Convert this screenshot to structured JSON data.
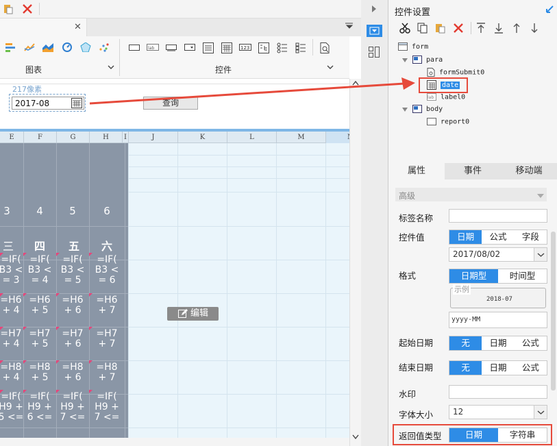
{
  "ribbon": {
    "chart_label": "图表",
    "control_label": "控件"
  },
  "form": {
    "size_hint": "217像素",
    "date_value": "2017-08",
    "query_button": "查询"
  },
  "grid": {
    "columns": [
      "E",
      "F",
      "G",
      "H",
      "I",
      "J",
      "K",
      "L",
      "M",
      "N"
    ],
    "rows": [
      [
        "3",
        "4",
        "5",
        "6"
      ],
      [
        "三",
        "四",
        "五",
        "六"
      ],
      [
        "=IF(\nB3 <\n= 3",
        "=IF(\nB3 <\n= 4",
        "=IF(\nB3 <\n= 5",
        "=IF(\nB3 <\n= 6"
      ],
      [
        "=H6\n+ 4",
        "=H6\n+ 5",
        "=H6\n+ 6",
        "=H6\n+ 7"
      ],
      [
        "=H7\n+ 4",
        "=H7\n+ 5",
        "=H7\n+ 6",
        "=H7\n+ 7"
      ],
      [
        "=H8\n+ 4",
        "=H8\n+ 5",
        "=H8\n+ 6",
        "=H8\n+ 7"
      ],
      [
        "=IF(\nH9 +\n5 <=",
        "=IF(\nH9 +\n6 <=",
        "=IF(\nH9 +\n7 <=",
        "=IF(\nH9 +\n7 <="
      ]
    ],
    "edit_button": "编辑"
  },
  "panel": {
    "title": "控件设置",
    "tree": [
      {
        "label": "form"
      },
      {
        "label": "para"
      },
      {
        "label": "formSubmit0"
      },
      {
        "label": "date"
      },
      {
        "label": "label0"
      },
      {
        "label": "body"
      },
      {
        "label": "report0"
      }
    ],
    "tabs": [
      "属性",
      "事件",
      "移动端"
    ],
    "section": "高级",
    "label_name": "标签名称",
    "control_value": "控件值",
    "control_value_options": [
      "日期",
      "公式",
      "字段"
    ],
    "control_value_date": "2017/08/02",
    "format": "格式",
    "format_options": [
      "日期型",
      "时间型"
    ],
    "example_label": "示例",
    "example_value": "2018-07",
    "format_input": "yyyy-MM",
    "start_date": "起始日期",
    "end_date": "结束日期",
    "date_options": [
      "无",
      "日期",
      "公式"
    ],
    "watermark": "水印",
    "font_size": "字体大小",
    "font_size_value": "12",
    "return_type": "返回值类型",
    "return_options": [
      "日期",
      "字符串"
    ]
  },
  "colors": {
    "accent": "#2e8ce6",
    "highlight": "#e64a3b",
    "cell_bg": "#8a96a6"
  }
}
